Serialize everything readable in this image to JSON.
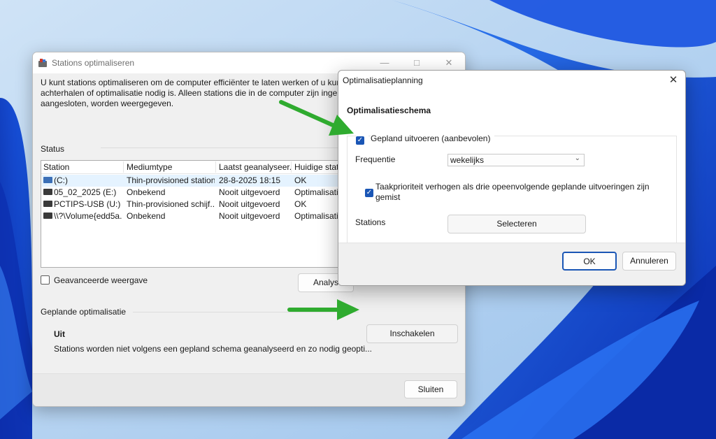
{
  "colors": {
    "accent": "#1a56b5",
    "arrow": "#2fab2f",
    "wallpaper_blue": "#0a3fcf"
  },
  "main_window": {
    "title": "Stations optimaliseren",
    "intro_lines": [
      "U kunt stations optimaliseren om de computer efficiënter te laten werken of u kunt",
      "achterhalen of optimalisatie nodig is. Alleen stations die in de computer zijn ingebo",
      "aangesloten, worden weergegeven."
    ],
    "status_label": "Status",
    "columns": [
      "Station",
      "Mediumtype",
      "Laatst geanalyseer...",
      "Huidige statu"
    ],
    "rows": [
      {
        "station": "(C:)",
        "type": "Thin-provisioned station",
        "last": "28-8-2025 18:15",
        "status": "OK"
      },
      {
        "station": "05_02_2025 (E:)",
        "type": "Onbekend",
        "last": "Nooit uitgevoerd",
        "status": "Optimalisatie"
      },
      {
        "station": "PCTIPS-USB (U:)",
        "type": "Thin-provisioned schijf...",
        "last": "Nooit uitgevoerd",
        "status": "OK"
      },
      {
        "station": "\\\\?\\Volume{edd5a...",
        "type": "Onbekend",
        "last": "Nooit uitgevoerd",
        "status": "Optimalisatie"
      }
    ],
    "advanced_view_label": "Geavanceerde weergave",
    "analyse_button": "Analys",
    "scheduled_label": "Geplande optimalisatie",
    "scheduled_state": "Uit",
    "scheduled_desc": "Stations worden niet volgens een gepland schema geanalyseerd en zo nodig geopti...",
    "enable_button": "Inschakelen",
    "close_button": "Sluiten"
  },
  "dialog": {
    "title": "Optimalisatieplanning",
    "schema_heading": "Optimalisatieschema",
    "scheduled_checkbox": "Gepland uitvoeren (aanbevolen)",
    "frequency_label": "Frequentie",
    "frequency_value": "wekelijks",
    "priority_checkbox": "Taakprioriteit verhogen als drie opeenvolgende geplande uitvoeringen zijn gemist",
    "stations_label": "Stations",
    "select_button": "Selecteren",
    "ok_button": "OK",
    "cancel_button": "Annuleren"
  }
}
